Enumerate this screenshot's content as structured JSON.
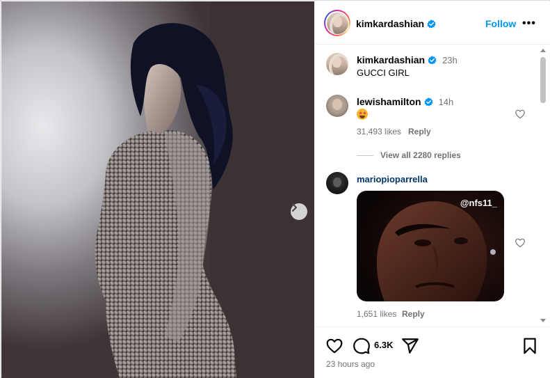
{
  "header": {
    "username": "kimkardashian",
    "follow_label": "Follow",
    "more_label": "•••"
  },
  "caption": {
    "username": "kimkardashian",
    "time": "23h",
    "text": "GUCCI GIRL"
  },
  "comments": [
    {
      "username": "lewishamilton",
      "verified": true,
      "time": "14h",
      "emoji": "star-struck-emoji",
      "likes": "31,493 likes",
      "reply_label": "Reply",
      "view_replies": "View all 2280 replies"
    },
    {
      "username": "mariopioparrella",
      "verified": false,
      "gif_tag": "@nfs11_",
      "likes": "1,651 likes",
      "reply_label": "Reply"
    }
  ],
  "actions": {
    "comment_count": "6.3K",
    "timestamp": "23 hours ago"
  },
  "colors": {
    "accent": "#0095f6",
    "verified": "#0095f6",
    "secondary_text": "#737373",
    "link_user": "#00376b"
  },
  "icons": [
    "chevron-right-icon",
    "verified-icon",
    "more-icon",
    "heart-icon",
    "comment-icon",
    "share-icon",
    "bookmark-icon"
  ]
}
